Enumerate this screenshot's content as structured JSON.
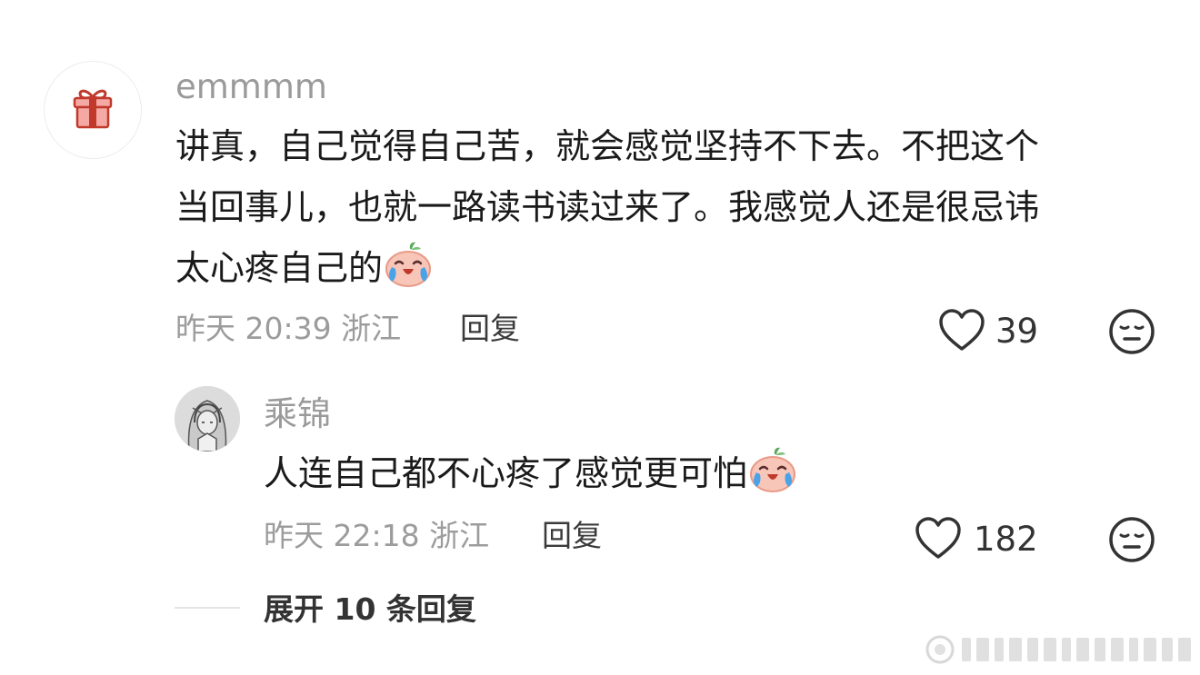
{
  "comment": {
    "avatar_icon": "gift-icon",
    "username": "emmmm",
    "content_lines": [
      "讲真，自己觉得自己苦，就会感觉坚持不下去。不把这个",
      "当回事儿，也就一路读书读过来了。我感觉人还是很忌讳",
      "太心疼自己的"
    ],
    "trailing_emoji": "crying-laughing-emoji",
    "date": "昨天",
    "time": "20:39",
    "location": "浙江",
    "reply_label": "回复",
    "like_icon": "heart-icon",
    "like_count": "39",
    "dislike_icon": "meh-face-icon"
  },
  "sub_reply": {
    "avatar_icon": "sketch-avatar",
    "username": "乘锦",
    "content": "人连自己都不心疼了感觉更可怕",
    "trailing_emoji": "crying-laughing-emoji",
    "date": "昨天",
    "time": "22:18",
    "location": "浙江",
    "reply_label": "回复",
    "like_icon": "heart-icon",
    "like_count": "182",
    "dislike_icon": "meh-face-icon"
  },
  "expand": {
    "label": "展开 10 条回复"
  },
  "watermark": {
    "icon": "weibo-watermark"
  }
}
